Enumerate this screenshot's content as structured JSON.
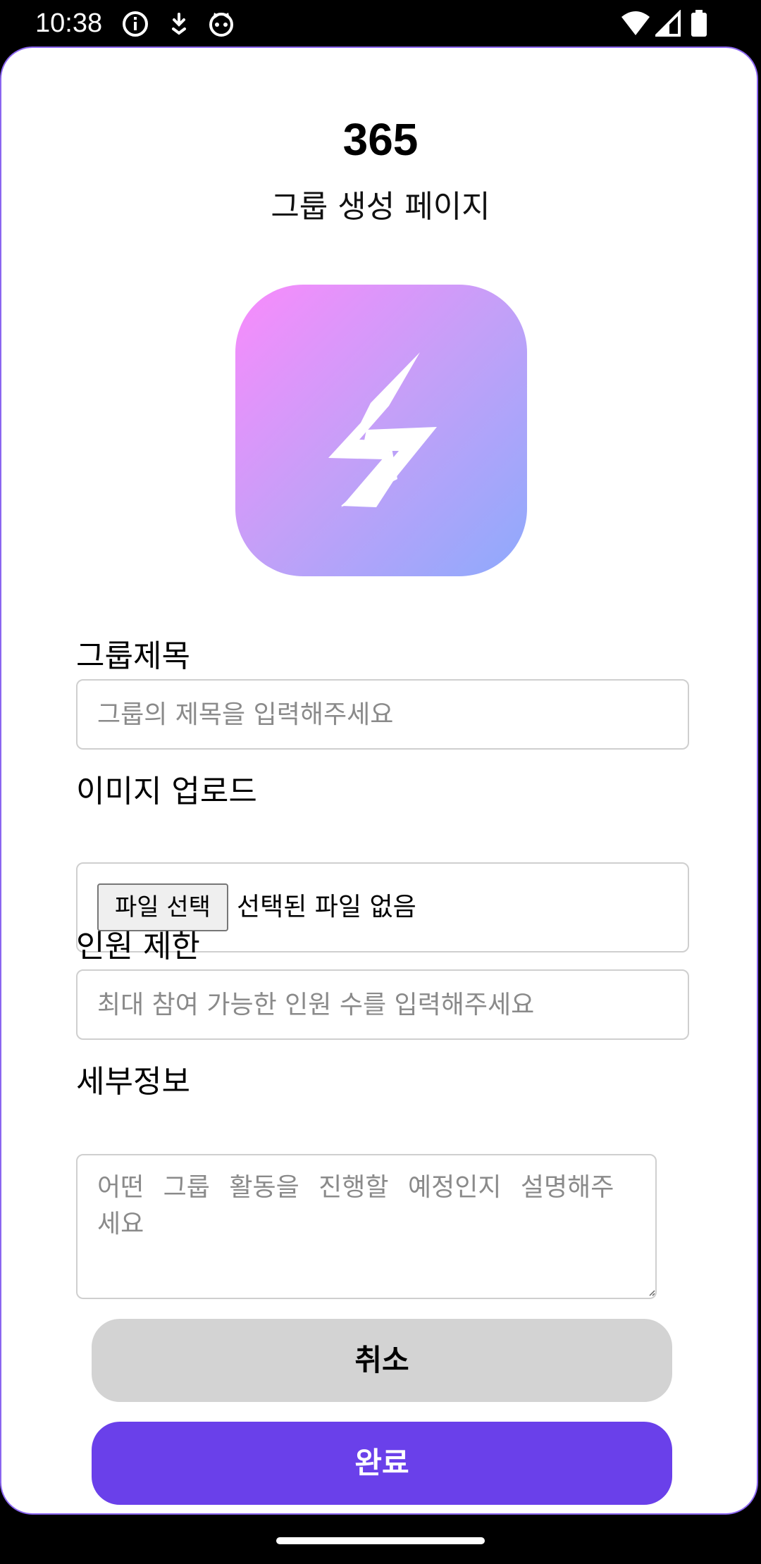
{
  "status_bar": {
    "time": "10:38",
    "icons_left": [
      "info-icon",
      "download-icon",
      "cat-face-icon"
    ],
    "icons_right": [
      "wifi-icon",
      "signal-icon",
      "battery-icon"
    ]
  },
  "header": {
    "app_title": "365",
    "page_title": "그룹 생성 페이지"
  },
  "logo": {
    "icon": "lightning-bolt-icon",
    "gradient_colors": [
      "#f98bfc",
      "#8eaafc"
    ]
  },
  "form": {
    "group_title": {
      "label": "그룹제목",
      "value": "",
      "placeholder": "그룹의 제목을 입력해주세요"
    },
    "image_upload": {
      "label": "이미지 업로드",
      "button_label": "파일 선택",
      "status": "선택된 파일 없음"
    },
    "member_limit": {
      "label": "인원 제한",
      "value": "",
      "placeholder": "최대 참여 가능한 인원 수를 입력해주세요"
    },
    "details": {
      "label": "세부정보",
      "value": "",
      "placeholder": "어떤 그룹 활동을 진행할 예정인지 설명해주세요"
    }
  },
  "actions": {
    "cancel_label": "취소",
    "done_label": "완료"
  },
  "colors": {
    "accent": "#6a40ea",
    "border_accent": "#8b66f0",
    "cancel_bg": "#d3d3d3"
  }
}
